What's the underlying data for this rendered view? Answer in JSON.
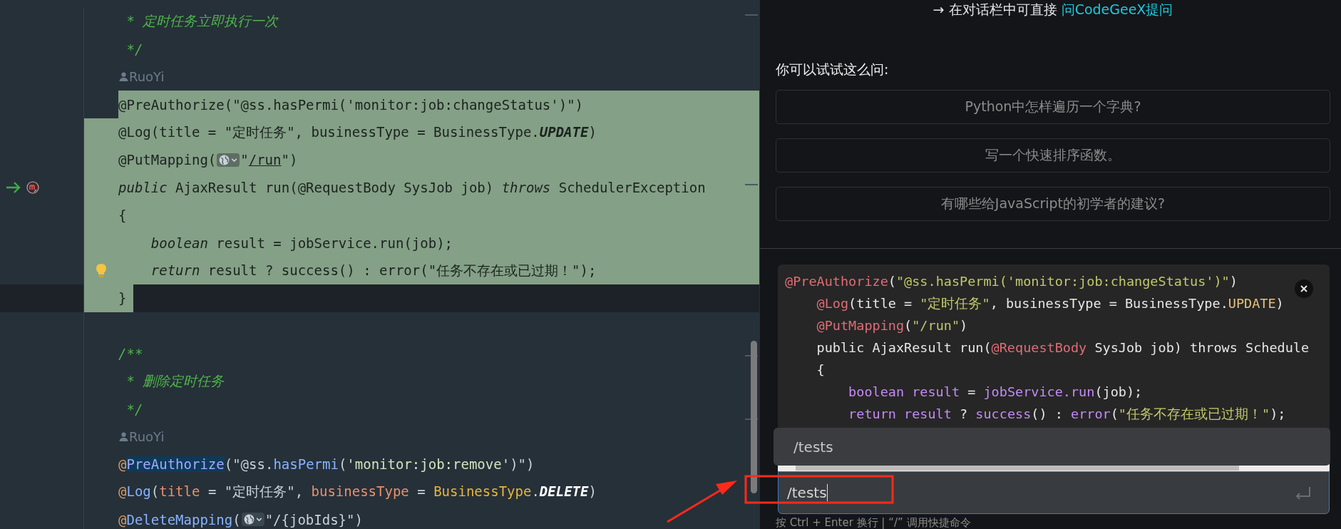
{
  "editor": {
    "lines": [
      {
        "kind": "code",
        "selected": false,
        "current": false,
        "tokens": [
          {
            "text": " * 定时任务立即执行一次",
            "kind": "comment"
          }
        ]
      },
      {
        "kind": "code",
        "selected": false,
        "current": false,
        "tokens": [
          {
            "text": " */",
            "kind": "comment"
          }
        ]
      },
      {
        "kind": "author",
        "selected": false,
        "current": false,
        "text": "RuoYi"
      },
      {
        "kind": "code",
        "selected": true,
        "current": false,
        "tokens": [
          {
            "text": "@PreAuthorize(\"@ss.hasPermi('monitor:job:changeStatus')\")",
            "kind": "plain"
          }
        ]
      },
      {
        "kind": "code",
        "selected": true,
        "current": false,
        "tokens": [
          {
            "text": "@Log(title = \"定时任务\", businessType = BusinessType.",
            "kind": "plain"
          },
          {
            "text": "UPDATE",
            "kind": "constant"
          },
          {
            "text": ")",
            "kind": "plain"
          }
        ]
      },
      {
        "kind": "code",
        "selected": true,
        "current": false,
        "tokens": [
          {
            "text": "@PutMapping(",
            "kind": "plain"
          },
          {
            "kind": "inlay"
          },
          {
            "text": "\"",
            "kind": "plain"
          },
          {
            "text": "/run",
            "kind": "url"
          },
          {
            "text": "\")",
            "kind": "plain"
          }
        ]
      },
      {
        "kind": "code",
        "selected": true,
        "current": false,
        "marker": {
          "kind": "implements"
        },
        "tokens": [
          {
            "text": "public",
            "kind": "keyword"
          },
          {
            "text": " AjaxResult run(@RequestBody SysJob job) ",
            "kind": "plain"
          },
          {
            "text": "throws",
            "kind": "keyword"
          },
          {
            "text": " SchedulerException",
            "kind": "plain"
          }
        ]
      },
      {
        "kind": "code",
        "selected": true,
        "current": false,
        "tokens": [
          {
            "text": "{",
            "kind": "plain"
          }
        ]
      },
      {
        "kind": "code",
        "selected": true,
        "current": false,
        "tokens": [
          {
            "text": "    boolean",
            "kind": "keyword"
          },
          {
            "text": " result = jobService.run(job);",
            "kind": "plain"
          }
        ]
      },
      {
        "kind": "code",
        "selected": true,
        "current": false,
        "marker": {
          "kind": "intention"
        },
        "tokens": [
          {
            "text": "    return",
            "kind": "keyword"
          },
          {
            "text": " result ? success() : error(\"任务不存在或已过期！\");",
            "kind": "plain"
          }
        ]
      },
      {
        "kind": "code",
        "selected": true,
        "current": true,
        "tokens": [
          {
            "text": "}",
            "kind": "plain"
          }
        ]
      },
      {
        "kind": "blank",
        "selected": false,
        "current": false
      },
      {
        "kind": "code",
        "selected": false,
        "current": false,
        "tokens": [
          {
            "text": "/**",
            "kind": "comment"
          }
        ]
      },
      {
        "kind": "code",
        "selected": false,
        "current": false,
        "tokens": [
          {
            "text": " * 删除定时任务",
            "kind": "comment"
          }
        ]
      },
      {
        "kind": "code",
        "selected": false,
        "current": false,
        "tokens": [
          {
            "text": " */",
            "kind": "comment"
          }
        ]
      },
      {
        "kind": "author",
        "selected": false,
        "current": false,
        "text": "RuoYi"
      },
      {
        "kind": "code",
        "selected": false,
        "current": false,
        "tokens": [
          {
            "text": "@",
            "kind": "at"
          },
          {
            "text": "PreAuthorize",
            "kind": "annotation-hl"
          },
          {
            "text": "(\"@ss.",
            "kind": "plain"
          },
          {
            "text": "hasPermi",
            "kind": "method"
          },
          {
            "text": "(",
            "kind": "plain"
          },
          {
            "text": "'monitor:job:remove'",
            "kind": "string"
          },
          {
            "text": ")\")",
            "kind": "plain"
          }
        ]
      },
      {
        "kind": "code",
        "selected": false,
        "current": false,
        "tokens": [
          {
            "text": "@",
            "kind": "at"
          },
          {
            "text": "Log",
            "kind": "annotation"
          },
          {
            "text": "(",
            "kind": "plain"
          },
          {
            "text": "title",
            "kind": "param"
          },
          {
            "text": " = \"定时任务\", ",
            "kind": "plain"
          },
          {
            "text": "businessType",
            "kind": "param"
          },
          {
            "text": " = ",
            "kind": "plain"
          },
          {
            "text": "BusinessType",
            "kind": "type"
          },
          {
            "text": ".",
            "kind": "plain"
          },
          {
            "text": "DELETE",
            "kind": "constant"
          },
          {
            "text": ")",
            "kind": "plain"
          }
        ]
      },
      {
        "kind": "code",
        "selected": false,
        "current": false,
        "tokens": [
          {
            "text": "@",
            "kind": "at"
          },
          {
            "text": "DeleteMapping",
            "kind": "annotation"
          },
          {
            "text": "(",
            "kind": "plain"
          },
          {
            "kind": "inlay"
          },
          {
            "text": "\"/{jobIds}\")",
            "kind": "plain"
          }
        ]
      }
    ]
  },
  "assistant": {
    "tip": {
      "text": "→ 在对话栏中可直接",
      "link": "问CodeGeeX提问"
    },
    "suggestions_title": "你可以试试这么问:",
    "suggestions": [
      "Python中怎样遍历一个字典?",
      "写一个快速排序函数。",
      "有哪些给JavaScript的初学者的建议?"
    ],
    "snippet": {
      "lines": [
        [
          {
            "text": "@PreAuthorize",
            "kind": "anno"
          },
          {
            "text": "(",
            "kind": "plain"
          },
          {
            "text": "\"@ss.hasPermi('monitor:job:changeStatus')\"",
            "kind": "str"
          },
          {
            "text": ")",
            "kind": "plain"
          }
        ],
        [
          {
            "text": "    @Log",
            "kind": "anno"
          },
          {
            "text": "(title = ",
            "kind": "plain"
          },
          {
            "text": "\"定时任务\"",
            "kind": "str"
          },
          {
            "text": ", businessType = BusinessType.",
            "kind": "plain"
          },
          {
            "text": "UPDATE",
            "kind": "const"
          },
          {
            "text": ")",
            "kind": "plain"
          }
        ],
        [
          {
            "text": "    @PutMapping",
            "kind": "anno"
          },
          {
            "text": "(",
            "kind": "plain"
          },
          {
            "text": "\"/run\"",
            "kind": "str"
          },
          {
            "text": ")",
            "kind": "plain"
          }
        ],
        [
          {
            "text": "    public AjaxResult run(",
            "kind": "plain"
          },
          {
            "text": "@RequestBody",
            "kind": "anno"
          },
          {
            "text": " SysJob job) throws Schedule",
            "kind": "plain"
          }
        ],
        [
          {
            "text": "    {",
            "kind": "plain"
          }
        ],
        [
          {
            "text": "        boolean result",
            "kind": "kw"
          },
          {
            "text": " = ",
            "kind": "plain"
          },
          {
            "text": "jobService.run",
            "kind": "kw"
          },
          {
            "text": "(job);",
            "kind": "plain"
          }
        ],
        [
          {
            "text": "        return result",
            "kind": "kw"
          },
          {
            "text": " ? ",
            "kind": "plain"
          },
          {
            "text": "success",
            "kind": "kw"
          },
          {
            "text": "() : ",
            "kind": "plain"
          },
          {
            "text": "error",
            "kind": "kw"
          },
          {
            "text": "(",
            "kind": "plain"
          },
          {
            "text": "\"任务不存在或已过期！\"",
            "kind": "str"
          },
          {
            "text": ");",
            "kind": "plain"
          }
        ]
      ]
    },
    "command_popup": {
      "items": [
        "/tests"
      ]
    },
    "input": {
      "value": "/tests"
    },
    "hint": "按 Ctrl + Enter 换行 | “/” 调用快捷命令"
  }
}
